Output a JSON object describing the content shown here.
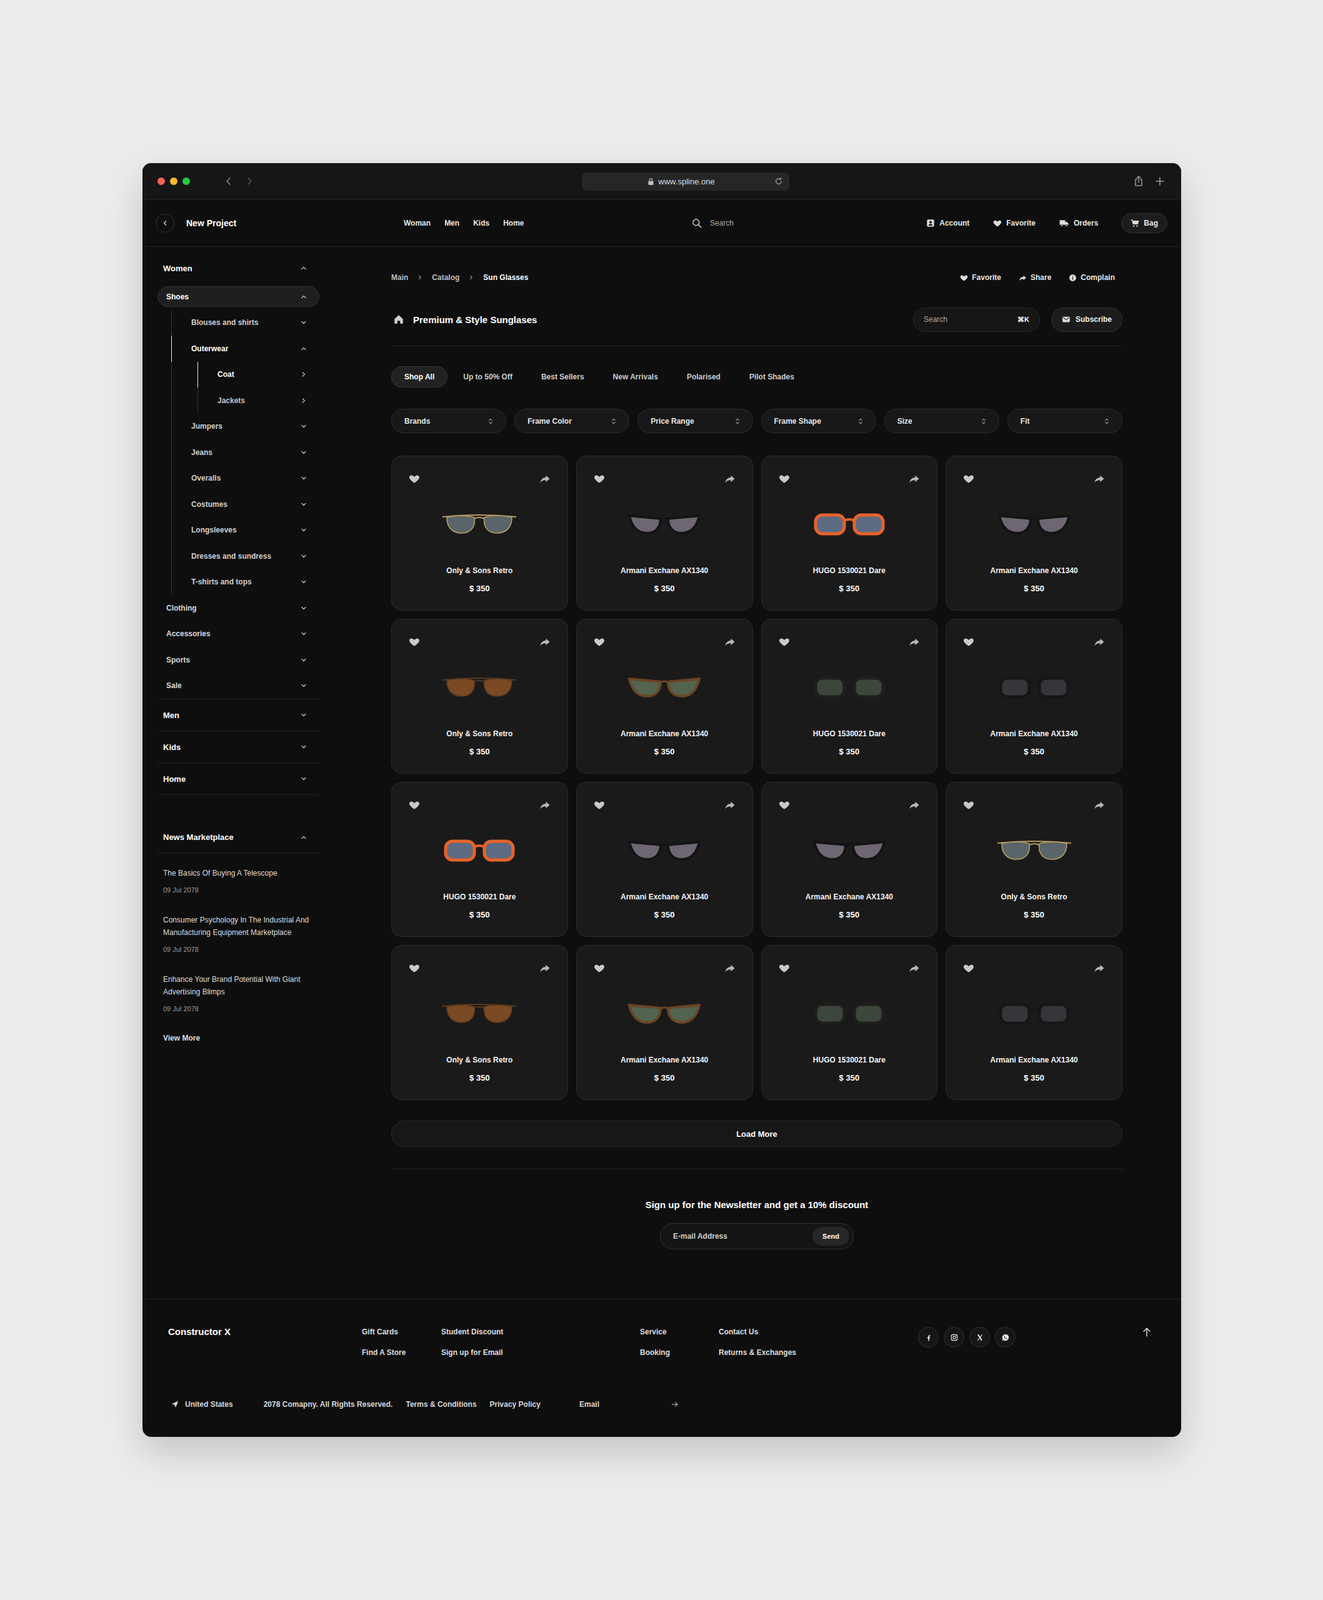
{
  "browser": {
    "url": "www.spline.one"
  },
  "header": {
    "project": "New Project",
    "nav": [
      {
        "label": "Woman"
      },
      {
        "label": "Men"
      },
      {
        "label": "Kids"
      },
      {
        "label": "Home"
      }
    ],
    "search": {
      "placeholder": "Search"
    },
    "actions": [
      {
        "label": "Account",
        "selected": false
      },
      {
        "label": "Favorite",
        "selected": false
      },
      {
        "label": "Orders",
        "selected": false
      },
      {
        "label": "Bag",
        "selected": true
      }
    ]
  },
  "sidebar": {
    "sections": [
      {
        "label": "Women",
        "expanded": true,
        "items": [
          {
            "label": "Shoes",
            "expanded": true,
            "selected": true,
            "items": [
              {
                "label": "Blouses and shirts",
                "expanded": false,
                "selected": false,
                "items": []
              },
              {
                "label": "Outerwear",
                "expanded": true,
                "selected": true,
                "items": [
                  {
                    "label": "Coat",
                    "selected": true
                  },
                  {
                    "label": "Jackets",
                    "selected": false
                  }
                ]
              },
              {
                "label": "Jumpers",
                "expanded": false,
                "selected": false,
                "items": []
              },
              {
                "label": "Jeans",
                "expanded": false,
                "selected": false,
                "items": []
              },
              {
                "label": "Overalls",
                "expanded": false,
                "selected": false,
                "items": []
              },
              {
                "label": "Costumes",
                "expanded": false,
                "selected": false,
                "items": []
              },
              {
                "label": "Longsleeves",
                "expanded": false,
                "selected": false,
                "items": []
              },
              {
                "label": "Dresses and sundress",
                "expanded": false,
                "selected": false,
                "items": []
              },
              {
                "label": "T-shirts and tops",
                "expanded": false,
                "selected": false,
                "items": []
              }
            ]
          },
          {
            "label": "Clothing",
            "expanded": false,
            "selected": false,
            "items": []
          },
          {
            "label": "Accessories",
            "expanded": false,
            "selected": false,
            "items": []
          },
          {
            "label": "Sports",
            "expanded": false,
            "selected": false,
            "items": []
          },
          {
            "label": "Sale",
            "expanded": false,
            "selected": false,
            "items": []
          }
        ]
      },
      {
        "label": "Men",
        "expanded": false,
        "items": []
      },
      {
        "label": "Kids",
        "expanded": false,
        "items": []
      },
      {
        "label": "Home",
        "expanded": false,
        "items": []
      }
    ]
  },
  "news": {
    "title": "News Marketplace",
    "expanded": true,
    "articles": [
      {
        "title": "The Basics Of Buying A Telescope",
        "date": "09 Jul 2078"
      },
      {
        "title": "Consumer Psychology In The Industrial And Manufacturing Equipment Marketplace",
        "date": "09 Jul 2078"
      },
      {
        "title": "Enhance Your Brand Potential With Giant Advertising Blimps",
        "date": "09 Jul 2078"
      }
    ],
    "more": "View More"
  },
  "page": {
    "breadcrumbs": [
      "Main",
      "Catalog",
      "Sun Glasses"
    ],
    "actions": [
      {
        "label": "Favorite"
      },
      {
        "label": "Share"
      },
      {
        "label": "Complain"
      }
    ],
    "title": "Premium & Style Sunglases",
    "search": {
      "placeholder": "Search",
      "shortcut": "⌘K"
    },
    "subscribe": "Subscribe"
  },
  "tabs": [
    {
      "label": "Shop All",
      "selected": true
    },
    {
      "label": "Up to 50% Off",
      "selected": false
    },
    {
      "label": "Best Sellers",
      "selected": false
    },
    {
      "label": "New Arrivals",
      "selected": false
    },
    {
      "label": "Polarised",
      "selected": false
    },
    {
      "label": "Pilot Shades",
      "selected": false
    }
  ],
  "filters": [
    {
      "label": "Brands"
    },
    {
      "label": "Frame Color"
    },
    {
      "label": "Price Range"
    },
    {
      "label": "Frame Shape"
    },
    {
      "label": "Size"
    },
    {
      "label": "Fit"
    }
  ],
  "products": [
    {
      "name": "Only & Sons Retro",
      "price": "$ 350",
      "favorite": false,
      "kind": "round",
      "color": "#b89b62",
      "lens_color": "#59656a"
    },
    {
      "name": "Armani Exchane AX1340",
      "price": "$ 350",
      "favorite": false,
      "kind": "cateye",
      "color": "#141414",
      "lens_color": "#6e6672"
    },
    {
      "name": "HUGO 1530021 Dare",
      "price": "$ 350",
      "favorite": false,
      "kind": "square",
      "color": "#e8622a",
      "lens_color": "#5d6b82"
    },
    {
      "name": "Armani Exchane AX1340",
      "price": "$ 350",
      "favorite": false,
      "kind": "cateye",
      "color": "#141414",
      "lens_color": "#6e6672"
    },
    {
      "name": "Only & Sons Retro",
      "price": "$ 350",
      "favorite": false,
      "kind": "round",
      "color": "#5a3a1e",
      "lens_color": "#7a4a24"
    },
    {
      "name": "Armani Exchane AX1340",
      "price": "$ 350",
      "favorite": false,
      "kind": "cateye",
      "color": "#6b4524",
      "lens_color": "#52634f"
    },
    {
      "name": "HUGO 1530021 Dare",
      "price": "$ 350",
      "favorite": false,
      "kind": "square",
      "color": "#1e1f1c",
      "lens_color": "#3c463b"
    },
    {
      "name": "Armani Exchane AX1340",
      "price": "$ 350",
      "favorite": false,
      "kind": "square",
      "color": "#161616",
      "lens_color": "#34363a"
    },
    {
      "name": "HUGO 1530021 Dare",
      "price": "$ 350",
      "favorite": false,
      "kind": "square",
      "color": "#e8622a",
      "lens_color": "#5d6b82"
    },
    {
      "name": "Armani Exchane AX1340",
      "price": "$ 350",
      "favorite": false,
      "kind": "cateye",
      "color": "#141414",
      "lens_color": "#6e6672"
    },
    {
      "name": "Armani Exchane AX1340",
      "price": "$ 350",
      "favorite": false,
      "kind": "cateye",
      "color": "#141414",
      "lens_color": "#6e6672"
    },
    {
      "name": "Only & Sons Retro",
      "price": "$ 350",
      "favorite": false,
      "kind": "round",
      "color": "#b89b62",
      "lens_color": "#59656a"
    },
    {
      "name": "Only & Sons Retro",
      "price": "$ 350",
      "favorite": false,
      "kind": "round",
      "color": "#5a3a1e",
      "lens_color": "#7a4a24"
    },
    {
      "name": "Armani Exchane AX1340",
      "price": "$ 350",
      "favorite": false,
      "kind": "cateye",
      "color": "#6b4524",
      "lens_color": "#52634f"
    },
    {
      "name": "HUGO 1530021 Dare",
      "price": "$ 350",
      "favorite": false,
      "kind": "square",
      "color": "#1e1f1c",
      "lens_color": "#3c463b"
    },
    {
      "name": "Armani Exchane AX1340",
      "price": "$ 350",
      "favorite": false,
      "kind": "square",
      "color": "#161616",
      "lens_color": "#34363a"
    }
  ],
  "load_more": "Load More",
  "newsletter": {
    "title": "Sign up for the Newsletter and get a 10% discount",
    "placeholder": "E-mail Address",
    "button": "Send"
  },
  "footer": {
    "brand": "Constructor X",
    "link_groups": [
      [
        "Gift Cards",
        "Find A Store"
      ],
      [
        "Student Discount",
        "Sign up for Email"
      ],
      [
        "Service",
        "Booking"
      ],
      [
        "Contact Us",
        "Returns & Exchanges"
      ]
    ],
    "location": "United States",
    "copyright": "2078 Comapny. All Rights Reserved.",
    "legal": [
      "Terms & Conditions",
      "Privacy Policy"
    ],
    "email_placeholder": "Email"
  }
}
